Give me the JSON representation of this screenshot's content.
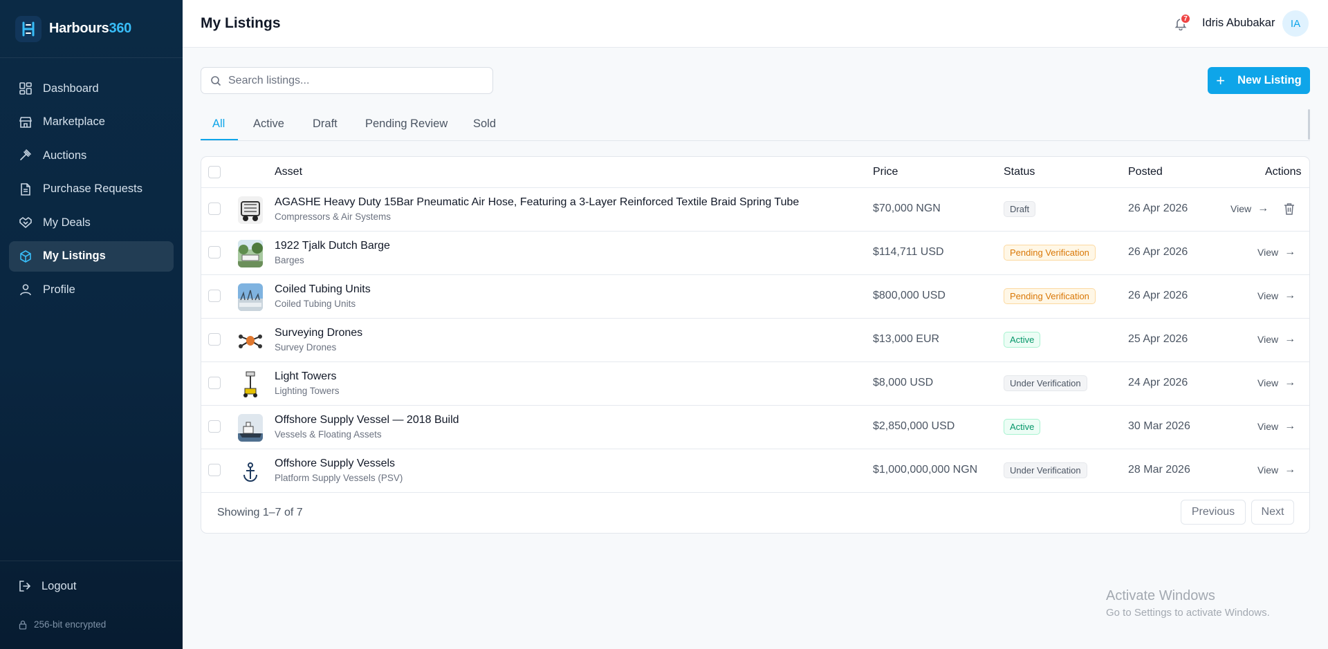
{
  "brand": {
    "name_main": "Harbours",
    "name_accent": "360"
  },
  "sidebar": {
    "items": [
      {
        "label": "Dashboard",
        "icon": "dashboard-icon",
        "active": false
      },
      {
        "label": "Marketplace",
        "icon": "store-icon",
        "active": false
      },
      {
        "label": "Auctions",
        "icon": "gavel-icon",
        "active": false
      },
      {
        "label": "Purchase Requests",
        "icon": "document-icon",
        "active": false
      },
      {
        "label": "My Deals",
        "icon": "handshake-icon",
        "active": false
      },
      {
        "label": "My Listings",
        "icon": "package-icon",
        "active": true
      },
      {
        "label": "Profile",
        "icon": "user-icon",
        "active": false
      }
    ],
    "logout_label": "Logout",
    "encrypted_label": "256-bit encrypted"
  },
  "header": {
    "title": "My Listings",
    "notification_count": "7",
    "user_name": "Idris Abubakar",
    "user_initials": "IA"
  },
  "toolbar": {
    "search_placeholder": "Search listings...",
    "new_listing_label": "New Listing"
  },
  "tabs": [
    {
      "label": "All",
      "active": true
    },
    {
      "label": "Active",
      "active": false
    },
    {
      "label": "Draft",
      "active": false
    },
    {
      "label": "Pending Review",
      "active": false
    },
    {
      "label": "Sold",
      "active": false
    }
  ],
  "table": {
    "columns": {
      "asset": "Asset",
      "price": "Price",
      "status": "Status",
      "posted": "Posted",
      "actions": "Actions"
    },
    "view_label": "View",
    "rows": [
      {
        "title": "AGASHE Heavy Duty 15Bar Pneumatic Air Hose, Featuring a 3-Layer Reinforced Textile Braid Spring Tube",
        "category": "Compressors & Air Systems",
        "price": "$70,000 NGN",
        "status": "Draft",
        "status_type": "draft",
        "posted": "26 Apr 2026",
        "deletable": true
      },
      {
        "title": "1922 Tjalk Dutch Barge",
        "category": "Barges",
        "price": "$114,711 USD",
        "status": "Pending Verification",
        "status_type": "pending",
        "posted": "26 Apr 2026",
        "deletable": false
      },
      {
        "title": "Coiled Tubing Units",
        "category": "Coiled Tubing Units",
        "price": "$800,000 USD",
        "status": "Pending Verification",
        "status_type": "pending",
        "posted": "26 Apr 2026",
        "deletable": false
      },
      {
        "title": "Surveying Drones",
        "category": "Survey Drones",
        "price": "$13,000 EUR",
        "status": "Active",
        "status_type": "active",
        "posted": "25 Apr 2026",
        "deletable": false
      },
      {
        "title": "Light Towers",
        "category": "Lighting Towers",
        "price": "$8,000 USD",
        "status": "Under Verification",
        "status_type": "under",
        "posted": "24 Apr 2026",
        "deletable": false
      },
      {
        "title": "Offshore Supply Vessel — 2018 Build",
        "category": "Vessels & Floating Assets",
        "price": "$2,850,000 USD",
        "status": "Active",
        "status_type": "active",
        "posted": "30 Mar 2026",
        "deletable": false
      },
      {
        "title": "Offshore Supply Vessels",
        "category": "Platform Supply Vessels (PSV)",
        "price": "$1,000,000,000 NGN",
        "status": "Under Verification",
        "status_type": "under",
        "posted": "28 Mar 2026",
        "deletable": false
      }
    ],
    "showing_text": "Showing 1–7 of 7",
    "previous_label": "Previous",
    "next_label": "Next"
  },
  "watermark": {
    "line1": "Activate Windows",
    "line2": "Go to Settings to activate Windows."
  }
}
